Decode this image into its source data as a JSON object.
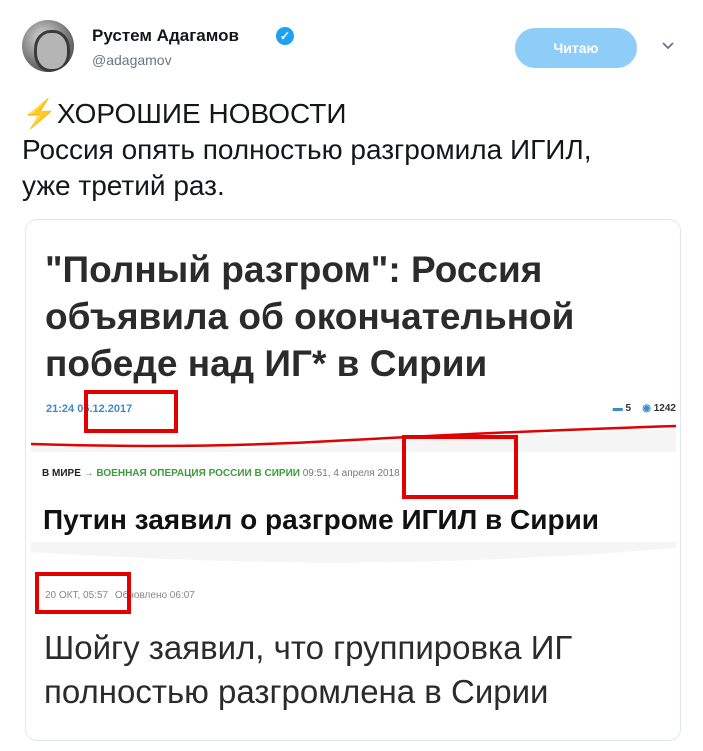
{
  "author": {
    "name": "Рустем Адагамов",
    "handle": "@adagamov",
    "verified_icon": "verified-badge-icon"
  },
  "follow_button": {
    "label": "Читаю"
  },
  "menu_icon": "chevron-down-icon",
  "tweet": {
    "line1_emoji": "⚡",
    "line1": "ХОРОШИЕ НОВОСТИ",
    "line2": "Россия опять полностью разгромила ИГИЛ,",
    "line3": "уже третий раз."
  },
  "card": {
    "headline1": "\"Полный разгром\": Россия объявила об окончательной победе над ИГ* в Сирии",
    "meta1_time": "21:24",
    "meta1_date": "06.12.2017",
    "meta1_comments": "5",
    "meta1_views": "1242",
    "meta2_section": "В МИРЕ",
    "meta2_arrow": "→",
    "meta2_topic": "ВОЕННАЯ ОПЕРАЦИЯ РОССИИ В СИРИИ",
    "meta2_date": "09:51, 4 апреля 2018",
    "headline2": "Путин заявил о разгроме ИГИЛ в Сирии",
    "meta3_date": "20 ОКТ, 05:57",
    "meta3_updated": "Обновлено 06:07",
    "headline3": "Шойгу заявил, что группировка ИГ полностью разгромлена в Сирии"
  },
  "colors": {
    "accent": "#1da1f2",
    "follow_button_bg": "#8ecdf7",
    "highlight_red": "#e30000"
  }
}
